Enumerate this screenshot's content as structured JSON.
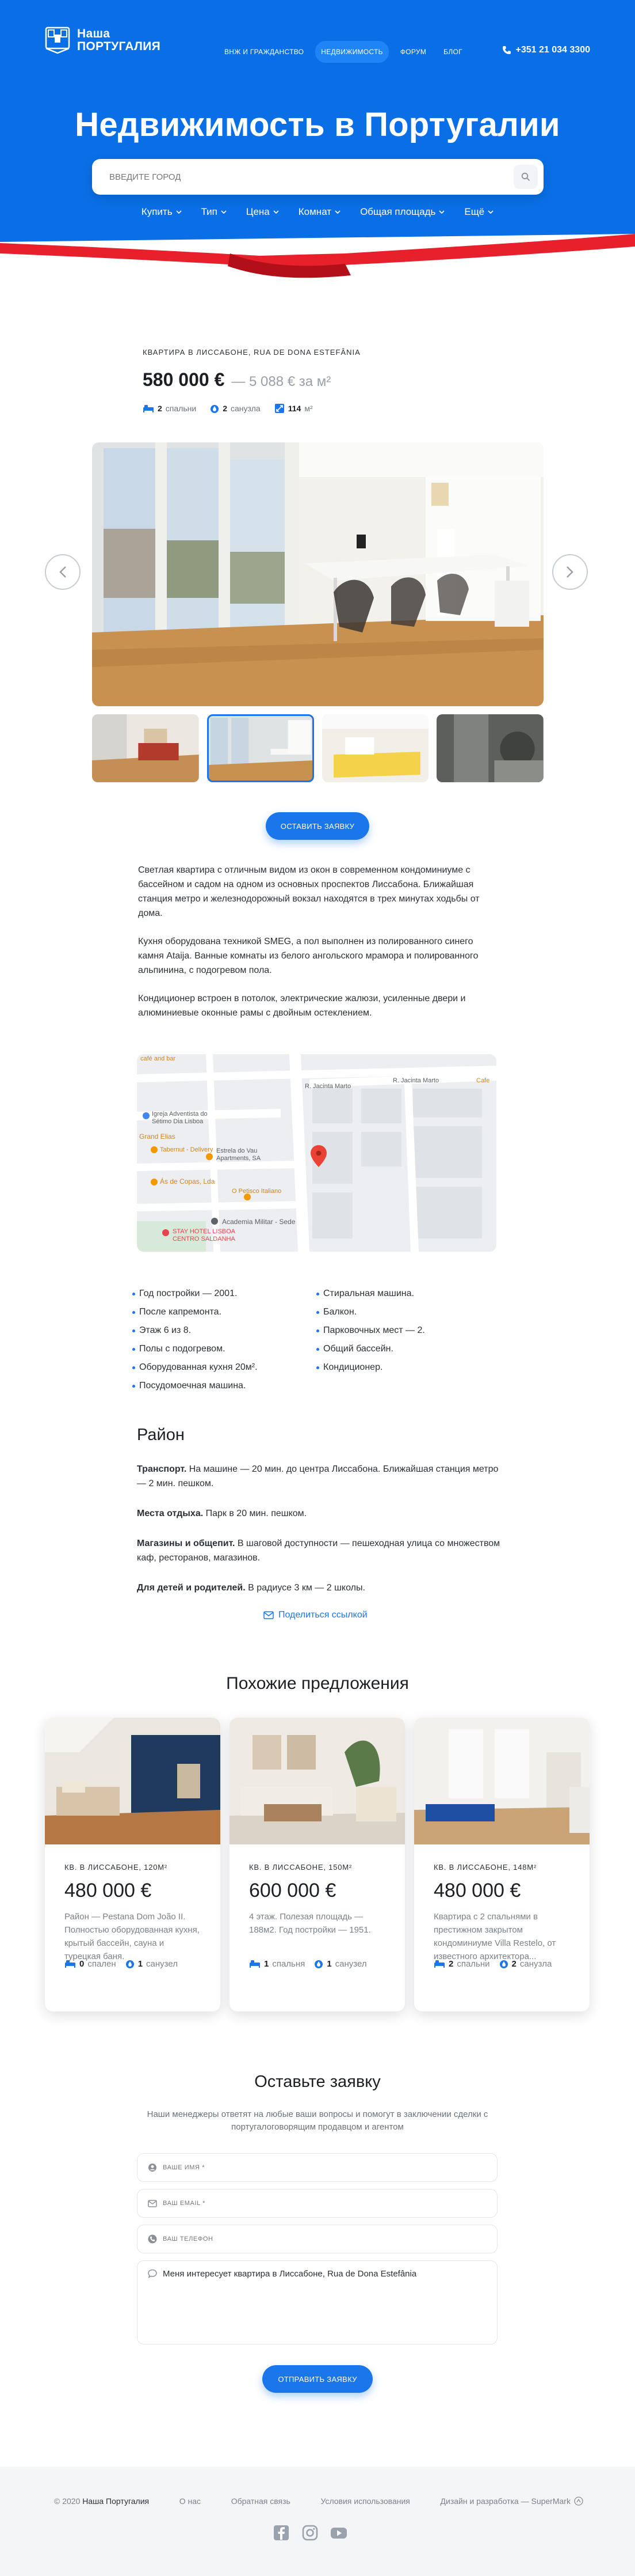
{
  "header": {
    "logo_line1": "Наша",
    "logo_line2": "Португалия",
    "nav": [
      "ВНЖ и гражданство",
      "Недвижимость",
      "Форум",
      "Блог"
    ],
    "nav_active_index": 1,
    "phone": "+351 21 034 3300"
  },
  "hero": {
    "title": "Недвижимость в Португалии",
    "search_placeholder": "Введите город",
    "filters": [
      "Купить",
      "Тип",
      "Цена",
      "Комнат",
      "Общая площадь",
      "Ещё"
    ]
  },
  "property": {
    "crumb": "Квартира в Лиссабоне, Rua de Dona Estefânia",
    "price": "580 000 €",
    "price_per_m2": "— 5 088 € за м²",
    "bedrooms_count": "2",
    "bedrooms_label": "спальни",
    "bathrooms_count": "2",
    "bathrooms_label": "санузла",
    "area_value": "114",
    "area_unit": "м²",
    "cta": "Оставить заявку",
    "thumb_active_index": 1
  },
  "description": [
    "Светлая квартира с отличным видом из окон в современном кондоминиуме с бассейном и садом на одном из основных проспектов Лиссабона. Ближайшая станция метро и железнодорожный вокзал находятся в трех минутах ходьбы от дома.",
    "Кухня оборудована техникой SMEG, а пол выполнен из полированного синего камня Ataija. Ванные комнаты из белого ангольского мрамора  и полированного альпинина, с подогревом пола.",
    "Кондиционер встроен в потолок, электрические жалюзи, усиленные двери и алюминиевые оконные рамы с двойным остеклением."
  ],
  "map": {
    "labels": [
      "café and bar",
      "Igreja Adventista do Sétimo Dia Lisboa",
      "Grand Elias",
      "Tabernut - Delivery",
      "Estrela do Vau Apartments, SA",
      "Ás de Copas, Lda",
      "O Petisco Italiano",
      "Academia Militar - Sede",
      "STAY HOTEL LISBOA CENTRO SALDANHA",
      "R. Jacinta Marto",
      "R. Jacinta Marto",
      "Cafe"
    ]
  },
  "features": {
    "left": [
      "Год постройки — 2001.",
      "После капремонта.",
      "Этаж 6 из 8.",
      "Полы с подогревом.",
      "Оборудованная кухня 20м².",
      "Посудомоечная машина."
    ],
    "right": [
      "Стиральная машина.",
      "Балкон.",
      "Парковочных мест — 2.",
      "Общий бассейн.",
      "Кондиционер."
    ]
  },
  "district": {
    "title": "Район",
    "items": [
      {
        "bold": "Транспорт.",
        "text": " На машине — 20 мин. до центра Лиссабона. Ближайшая станция метро — 2 мин. пешком."
      },
      {
        "bold": "Места отдыха.",
        "text": " Парк в 20 мин. пешком."
      },
      {
        "bold": "Магазины и общепит.",
        "text": " В шаговой доступности — пешеходная улица со множеством каф, ресторанов, магазинов."
      },
      {
        "bold": "Для детей и родителей.",
        "text": " В радиусе 3 км — 2 школы."
      }
    ],
    "share": "Поделиться ссылкой"
  },
  "similar": {
    "title": "Похожие предложения",
    "cards": [
      {
        "crumb": "Кв. в Лиссабоне, 120м²",
        "price": "480 000 €",
        "text": "Район — Pestana Dom João II. Полностью оборудованная кухня, крытый бассейн, сауна и турецкая баня.",
        "beds": "0",
        "beds_label": "спален",
        "baths": "1",
        "baths_label": "санузел"
      },
      {
        "crumb": "Кв. в Лиссабоне, 150м²",
        "price": "600 000 €",
        "text": "4 этаж. Полезая площадь — 188м2. Год постройки — 1951.",
        "beds": "1",
        "beds_label": "спальня",
        "baths": "1",
        "baths_label": "санузел"
      },
      {
        "crumb": "Кв. в Лиссабоне, 148м²",
        "price": "480 000 €",
        "text": "Квартира с 2 спальнями в престижном закрытом кондоминиуме Villa Restelo, от известного архитектора...",
        "beds": "2",
        "beds_label": "спальни",
        "baths": "2",
        "baths_label": "санузла"
      }
    ]
  },
  "form": {
    "title": "Оставьте заявку",
    "subtitle": "Наши менеджеры ответят на любые ваши вопросы  и помогут в заключении сделки с португалоговорящим продавцом и агентом",
    "name_placeholder": "Ваше имя *",
    "email_placeholder": "Ваш email *",
    "phone_placeholder": "Ваш телефон",
    "message": "Меня интересует квартира в Лиссабоне, Rua de Dona Estefânia",
    "submit": "Отправить заявку"
  },
  "footer": {
    "copyright_prefix": "© 2020",
    "copyright_brand": "Наша Португалия",
    "links": [
      "О нас",
      "Обратная связь",
      "Условия использования"
    ],
    "credit": "Дизайн и разработка — SuperMark"
  },
  "colors": {
    "brand_blue": "#0a6fe6",
    "accent": "#1a76ea",
    "stripe_red": "#e8202b"
  }
}
